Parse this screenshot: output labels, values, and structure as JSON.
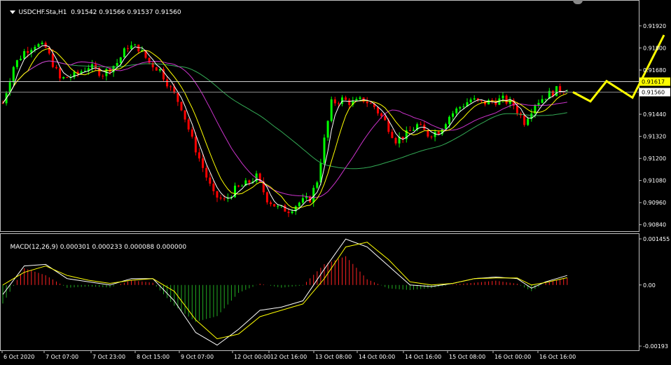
{
  "main_header": {
    "symbol_label": "USDCHF.Sta,H1",
    "ohlc": "0.91542 0.91566 0.91537 0.91560"
  },
  "macd_header": {
    "label": "MACD(12,26,9)",
    "values": "0.000301 0.000233 0.000088 0.000000"
  },
  "price_axis": {
    "ticks": [
      "0.91920",
      "0.91800",
      "0.91680",
      "0.91560",
      "0.91440",
      "0.91320",
      "0.91200",
      "0.91080",
      "0.90960",
      "0.90840"
    ],
    "highlight_line_label": "0.91617",
    "current_price_label": "0.91560"
  },
  "macd_axis": {
    "ticks": [
      "0.001455",
      "0.00",
      "-0.00193"
    ]
  },
  "time_axis": {
    "labels": [
      "6 Oct 2020",
      "7 Oct 07:00",
      "7 Oct 23:00",
      "8 Oct 15:00",
      "9 Oct 07:00",
      "12 Oct 00:00",
      "12 Oct 16:00",
      "13 Oct 08:00",
      "14 Oct 00:00",
      "14 Oct 16:00",
      "15 Oct 08:00",
      "16 Oct 00:00",
      "16 Oct 16:00"
    ]
  },
  "colors": {
    "bull": "#00ff00",
    "bear": "#ff0000",
    "ma_fast": "#ffffff",
    "ma_mid": "#ffff00",
    "ma_slow": "#cc33cc",
    "ma_long": "#33aa55",
    "forecast": "#ffff00",
    "hline": "#d0d0d0",
    "hline_label_bg": "#ffff00",
    "hist_pos": "#ff2222",
    "hist_neg": "#22aa22"
  },
  "chart_data": {
    "type": "candlestick",
    "symbol": "USDCHF.Sta",
    "timeframe": "H1",
    "y_range": [
      0.9082,
      0.9203
    ],
    "hline_level": 0.91617,
    "current_price": 0.9156,
    "close_path": [
      [
        0,
        0.915
      ],
      [
        3,
        0.917
      ],
      [
        6,
        0.9178
      ],
      [
        9,
        0.9182
      ],
      [
        12,
        0.918
      ],
      [
        16,
        0.9163
      ],
      [
        20,
        0.9165
      ],
      [
        24,
        0.917
      ],
      [
        28,
        0.9166
      ],
      [
        32,
        0.9172
      ],
      [
        35,
        0.9181
      ],
      [
        38,
        0.918
      ],
      [
        41,
        0.9172
      ],
      [
        44,
        0.9168
      ],
      [
        47,
        0.9158
      ],
      [
        50,
        0.9148
      ],
      [
        53,
        0.913
      ],
      [
        56,
        0.9115
      ],
      [
        59,
        0.91
      ],
      [
        62,
        0.9097
      ],
      [
        65,
        0.9103
      ],
      [
        68,
        0.9106
      ],
      [
        71,
        0.911
      ],
      [
        74,
        0.9098
      ],
      [
        77,
        0.9093
      ],
      [
        80,
        0.9092
      ],
      [
        83,
        0.9096
      ],
      [
        86,
        0.9098
      ],
      [
        88,
        0.9108
      ],
      [
        90,
        0.913
      ],
      [
        92,
        0.915
      ],
      [
        95,
        0.9152
      ],
      [
        98,
        0.915
      ],
      [
        101,
        0.9152
      ],
      [
        104,
        0.9148
      ],
      [
        107,
        0.914
      ],
      [
        110,
        0.913
      ],
      [
        113,
        0.9133
      ],
      [
        116,
        0.9138
      ],
      [
        119,
        0.9133
      ],
      [
        122,
        0.9135
      ],
      [
        125,
        0.9143
      ],
      [
        128,
        0.9148
      ],
      [
        131,
        0.9152
      ],
      [
        134,
        0.915
      ],
      [
        137,
        0.9151
      ],
      [
        140,
        0.9152
      ],
      [
        143,
        0.9149
      ],
      [
        146,
        0.914
      ],
      [
        149,
        0.915
      ],
      [
        152,
        0.9154
      ],
      [
        155,
        0.9157
      ],
      [
        158,
        0.9158
      ]
    ],
    "macd_range": [
      -0.00193,
      0.001455
    ],
    "macd_main_path": [
      [
        0,
        -0.0003
      ],
      [
        6,
        0.0006
      ],
      [
        12,
        0.00065
      ],
      [
        18,
        0.0002
      ],
      [
        24,
        0.0001
      ],
      [
        30,
        0.0
      ],
      [
        36,
        0.0002
      ],
      [
        42,
        0.0002
      ],
      [
        48,
        -0.0005
      ],
      [
        54,
        -0.0015
      ],
      [
        60,
        -0.0019
      ],
      [
        66,
        -0.0014
      ],
      [
        72,
        -0.0008
      ],
      [
        78,
        -0.0007
      ],
      [
        84,
        -0.0005
      ],
      [
        90,
        0.0005
      ],
      [
        96,
        0.00145
      ],
      [
        102,
        0.0012
      ],
      [
        108,
        0.0006
      ],
      [
        114,
        0.0
      ],
      [
        120,
        -5e-05
      ],
      [
        126,
        5e-05
      ],
      [
        132,
        0.0002
      ],
      [
        138,
        0.00025
      ],
      [
        144,
        0.0002
      ],
      [
        148,
        -0.0001
      ],
      [
        152,
        0.0001
      ],
      [
        158,
        0.0003
      ]
    ],
    "macd_signal_path": [
      [
        0,
        0.0
      ],
      [
        6,
        0.0004
      ],
      [
        12,
        0.0006
      ],
      [
        18,
        0.0003
      ],
      [
        24,
        0.00015
      ],
      [
        30,
        5e-05
      ],
      [
        36,
        0.00015
      ],
      [
        42,
        0.0002
      ],
      [
        48,
        -0.0002
      ],
      [
        54,
        -0.0011
      ],
      [
        60,
        -0.0017
      ],
      [
        66,
        -0.00155
      ],
      [
        72,
        -0.001
      ],
      [
        78,
        -0.0008
      ],
      [
        84,
        -0.0006
      ],
      [
        90,
        0.0002
      ],
      [
        96,
        0.0012
      ],
      [
        102,
        0.00135
      ],
      [
        108,
        0.0008
      ],
      [
        114,
        0.0001
      ],
      [
        120,
        0.0
      ],
      [
        126,
        5e-05
      ],
      [
        132,
        0.0002
      ],
      [
        138,
        0.00022
      ],
      [
        144,
        0.00022
      ],
      [
        148,
        0.0
      ],
      [
        152,
        8e-05
      ],
      [
        158,
        0.00023
      ]
    ],
    "forecast_path": [
      [
        0.9156,
        0.91585
      ],
      [
        0.9151,
        0.9151
      ],
      [
        0.9162,
        0.91617
      ],
      [
        0.9153,
        0.9153
      ],
      [
        0.9187,
        0.9187
      ]
    ]
  }
}
